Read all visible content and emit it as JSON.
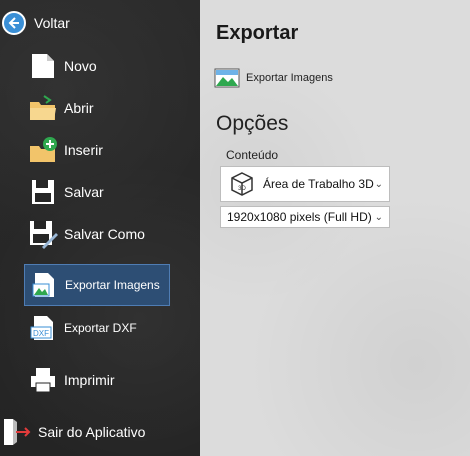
{
  "sidebar": {
    "back_label": "Voltar",
    "items": [
      {
        "label": "Novo"
      },
      {
        "label": "Abrir"
      },
      {
        "label": "Inserir"
      },
      {
        "label": "Salvar"
      },
      {
        "label": "Salvar Como"
      },
      {
        "label": "Exportar Imagens"
      },
      {
        "label": "Exportar DXF"
      },
      {
        "label": "Imprimir"
      },
      {
        "label": "Sair do Aplicativo"
      }
    ],
    "selected": "Exportar Imagens"
  },
  "main": {
    "title": "Exportar",
    "tab_label": "Exportar Imagens",
    "options_heading": "Opções",
    "content_label": "Conteúdo",
    "content_select": "Área de Trabalho 3D",
    "resolution_select": "1920x1080 pixels (Full HD)"
  },
  "colors": {
    "sidebar_bg": "#262626",
    "selected_bg": "#2d4e74",
    "selected_border": "#4f7db4",
    "main_bg": "#dcdcdc",
    "back_circle": "#3a8fd6"
  },
  "icons": {
    "back": "arrow-left-circle-icon",
    "novo": "blank-document-icon",
    "abrir": "open-folder-icon",
    "inserir": "insert-folder-plus-icon",
    "salvar": "floppy-disk-icon",
    "salvar_como": "floppy-pencil-icon",
    "exportar_imagens": "image-document-icon",
    "exportar_dxf": "dxf-file-icon",
    "imprimir": "printer-icon",
    "sair": "exit-door-icon"
  }
}
